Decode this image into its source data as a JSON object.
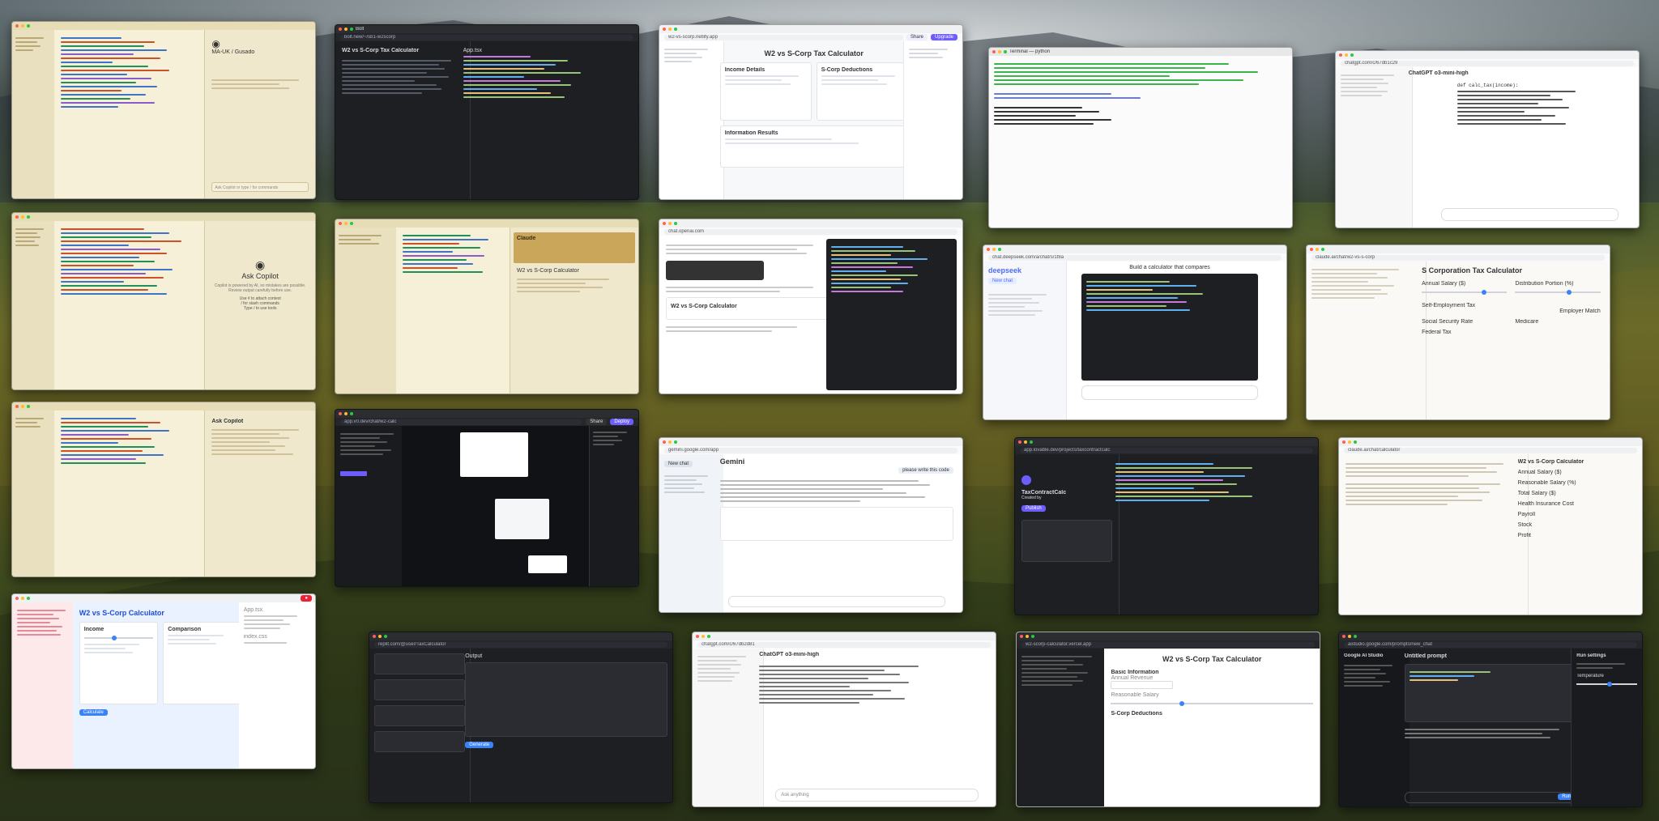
{
  "desktop": {
    "wallpaper": "mountain valley terraces",
    "colors": {
      "accent_blue": "#3b82f6",
      "purple": "#6d5dfc",
      "ide_cream": "#f3ecd2",
      "dark": "#1e1f22"
    }
  },
  "windows": {
    "w1": {
      "chat_title": "MA-UK / Gusado",
      "panel_label": "Ask Copilot",
      "input_placeholder": "Ask Copilot or type / for commands"
    },
    "w2": {
      "tab": "Bolt",
      "url": "bolt.new/~/sb1-w2scorp",
      "title": "W2 vs S-Corp Tax Calculator",
      "file": "App.tsx"
    },
    "w3": {
      "url": "w2-vs-scorp.netlify.app",
      "title": "W2 vs S-Corp Tax Calculator",
      "col1": "Income Details",
      "col2": "S-Corp Deductions",
      "col3": "Information Results",
      "btn_share": "Share",
      "btn_upgrade": "Upgrade"
    },
    "w4": {
      "title": "Terminal — python"
    },
    "w5": {
      "url": "chatgpt.com/c/67db1c29",
      "model": "ChatGPT o3-mini-high",
      "code_hint": "def calc_tax(income):"
    },
    "w6": {
      "panel_label": "Ask Copilot",
      "panel_sub": "Copilot is powered by AI, so mistakes are possible. Review output carefully before use.",
      "links": [
        "Use # to attach context",
        "/ for slash commands",
        "Type / to use tools"
      ]
    },
    "w7": {
      "title": "Claude",
      "label": "W2 vs S-Corp Calculator"
    },
    "w8": {
      "url": "chat.openai.com",
      "title": "W2 vs S-Corp Calculator"
    },
    "w9": {
      "url": "chat.deepseek.com/a/chat/s/1f8a",
      "logo": "deepseek",
      "new_chat": "New chat",
      "preview_title": "Build a calculator that compares"
    },
    "w10": {
      "url": "claude.ai/chat/w2-vs-s-corp",
      "title": "S Corporation Tax Calculator",
      "field1": "Annual Salary ($)",
      "field2": "Distribution Portion (%)",
      "toggle": "Employer Match",
      "field3": "Self-Employment Tax",
      "field4": "Social Security Rate",
      "field5": "Medicare",
      "field6": "Federal Tax"
    },
    "w11": {
      "panel_label": "Ask Copilot"
    },
    "w12": {
      "url": "app.v0.dev/chat/w2-calc",
      "share": "Share",
      "deploy": "Deploy"
    },
    "w13": {
      "url": "gemini.google.com/app",
      "brand": "Gemini",
      "user_msg": "please write this code",
      "new_chat": "New chat"
    },
    "w14": {
      "url": "app.lovable.dev/projects/taxcontractcalc",
      "project": "TaxContractCalc",
      "sub": "Created by ",
      "action": "Publish"
    },
    "w15": {
      "url": "claude.ai/chat/calculator",
      "title": "W2 vs S-Corp Calculator",
      "fields": [
        "Annual Salary ($)",
        "Reasonable Salary (%)",
        "Total Salary ($)",
        "Health Insurance Cost",
        "Payroll",
        "Stock",
        "Profit"
      ]
    },
    "w16": {
      "title": "W2 vs S-Corp Calculator",
      "panel_title": "Income",
      "panel2": "Comparison",
      "button": "Calculate",
      "tabs": [
        "App.tsx",
        "index.css"
      ]
    },
    "w17": {
      "url": "replit.com/@user/TaxCalculator",
      "btn": "Generate",
      "output": "Output"
    },
    "w18": {
      "url": "chatgpt.com/c/67db2d81",
      "model": "ChatGPT o3-mini-high",
      "input_placeholder": "Ask anything"
    },
    "w19": {
      "url": "w2-scorp-calculator.vercel.app",
      "title": "W2 vs S-Corp Tax Calculator",
      "section1": "Basic Information",
      "label1": "Annual Revenue",
      "label2": "Reasonable Salary",
      "section2": "S-Corp Deductions"
    },
    "w20": {
      "url": "aistudio.google.com/prompts/new_chat",
      "brand": "Google AI Studio",
      "title": "Untitled prompt",
      "run": "Run",
      "run_settings": "Run settings",
      "temperature": "Temperature"
    }
  }
}
